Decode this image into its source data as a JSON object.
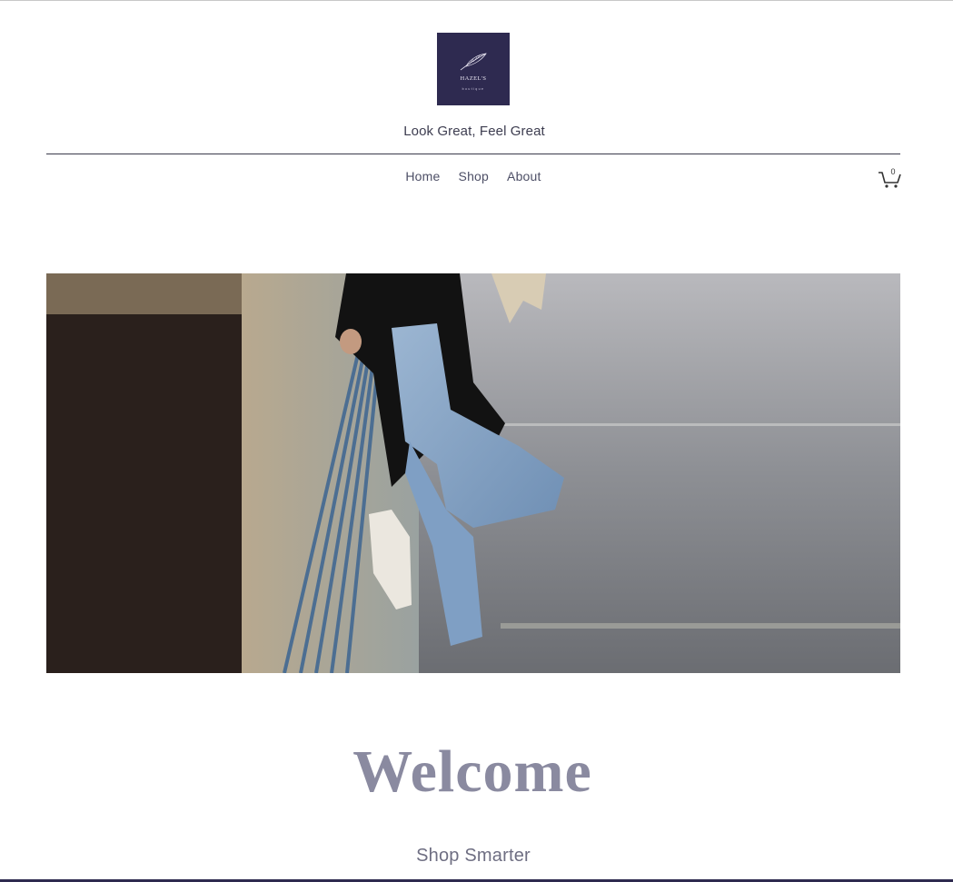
{
  "brand": {
    "logo_name": "HAZEL'S",
    "logo_sub": "boutique",
    "logo_bg": "#2e2a50",
    "tagline": "Look Great, Feel Great"
  },
  "nav": {
    "items": [
      {
        "label": "Home"
      },
      {
        "label": "Shop"
      },
      {
        "label": "About"
      }
    ]
  },
  "cart": {
    "icon": "cart-icon",
    "count": "0"
  },
  "hero": {
    "image": "woman-in-jeans-leaning-on-railing"
  },
  "main": {
    "heading": "Welcome",
    "subheading": "Shop Smarter"
  },
  "colors": {
    "accent": "#2e2a50",
    "heading": "#8a8aa0"
  }
}
